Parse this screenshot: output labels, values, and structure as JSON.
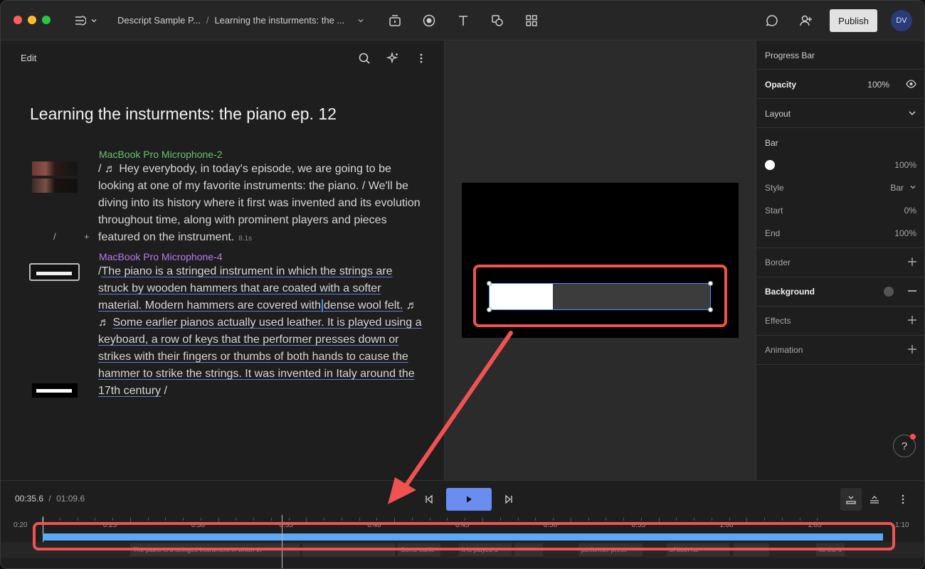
{
  "header": {
    "breadcrumb_project": "Descript Sample P...",
    "breadcrumb_sep": "/",
    "breadcrumb_doc": "Learning the insturments: the ...",
    "publish_label": "Publish",
    "avatar_initials": "DV"
  },
  "editor": {
    "edit_label": "Edit",
    "title": "Learning the insturments: the piano ep. 12",
    "speaker1": "MacBook Pro Microphone-2",
    "para1_pre": "/  ♬  ",
    "para1": "Hey everybody, in today's episode, we are going to be looking at one of my favorite instruments: the piano. / We'll be diving into its history where it first was invented and its evolution throughout time, along with prominent players and pieces featured on the instrument.",
    "para1_gap": "8.1s",
    "slash": "/",
    "plus": "+",
    "speaker2": "MacBook Pro Microphone-4",
    "para2_pre": "/",
    "para2_a": "The piano is a stringed instrument in which the strings are struck by wooden hammers that are coated with a softer material. Modern hammers are covered with",
    "para2_b": "dense wool felt.",
    "para2_notes": "  ♬    ♬  ",
    "para2_c": "Some earlier pianos actually used leather. It is played using a keyboard, a row of keys that the performer presses down or strikes with their fingers or thumbs of both hands to cause the hammer to strike the strings. It was invented in Italy around the 17th century",
    "para2_end": " /"
  },
  "canvas": {
    "progress_fraction": 0.29
  },
  "props": {
    "title": "Progress Bar",
    "opacity_label": "Opacity",
    "opacity_value": "100%",
    "layout_label": "Layout",
    "bar_label": "Bar",
    "bar_color_value": "100%",
    "style_label": "Style",
    "style_value": "Bar",
    "start_label": "Start",
    "start_value": "0%",
    "end_label": "End",
    "end_value": "100%",
    "border_label": "Border",
    "background_label": "Background",
    "effects_label": "Effects",
    "animation_label": "Animation",
    "help": "?"
  },
  "timeline": {
    "current": "00:35.6",
    "sep": "/",
    "total": "01:09.6",
    "ticks": [
      "0:20",
      "0:25",
      "0:30",
      "0:35",
      "0:40",
      "0:45",
      "0:50",
      "0:55",
      "1:00",
      "1:05",
      "1:10"
    ],
    "clips": [
      "The piano is a stringed instrument in which th",
      "Some earlie",
      "It is played u",
      "performer press",
      "of both ha",
      "ke the s"
    ]
  },
  "colors": {
    "accent": "#6a8ef0",
    "annotation": "#f05252",
    "track": "#5aa9f5"
  }
}
